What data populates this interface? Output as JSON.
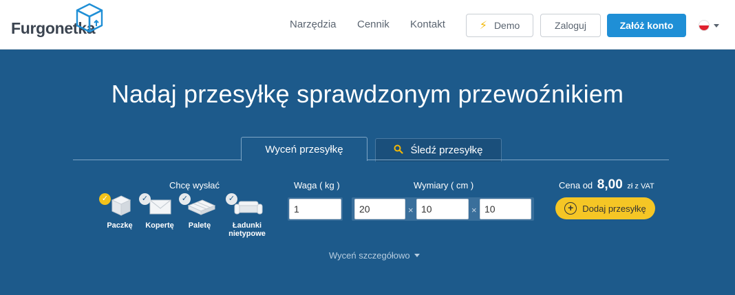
{
  "header": {
    "logo_text": "Furgonetka",
    "nav": [
      "Narzędzia",
      "Cennik",
      "Kontakt"
    ],
    "demo_label": "Demo",
    "login_label": "Zaloguj",
    "register_label": "Załóż konto",
    "language_icon": "poland-flag-icon"
  },
  "hero": {
    "title": "Nadaj przesyłkę sprawdzonym przewoźnikiem",
    "tabs": {
      "active": "Wyceń przesyłkę",
      "inactive": "Śledź przesyłkę"
    },
    "send_label": "Chcę wysłać",
    "ship_types": [
      {
        "label": "Paczkę",
        "selected": true
      },
      {
        "label": "Kopertę",
        "selected": false
      },
      {
        "label": "Paletę",
        "selected": false
      },
      {
        "label": "Ładunki nietypowe",
        "selected": false
      }
    ],
    "weight_label": "Waga ( kg )",
    "weight_value": "1",
    "dims_label": "Wymiary ( cm )",
    "dims": {
      "length": "20",
      "width": "10",
      "height": "10"
    },
    "times_symbol": "×",
    "price_prefix": "Cena od",
    "price_amount": "8,00",
    "price_suffix": "zł z VAT",
    "add_label": "Dodaj przesyłkę",
    "detail_link": "Wyceń szczegółowo"
  },
  "colors": {
    "hero_bg": "#1d5a8b",
    "accent_blue": "#1f8fd6",
    "accent_yellow": "#f5c625"
  }
}
